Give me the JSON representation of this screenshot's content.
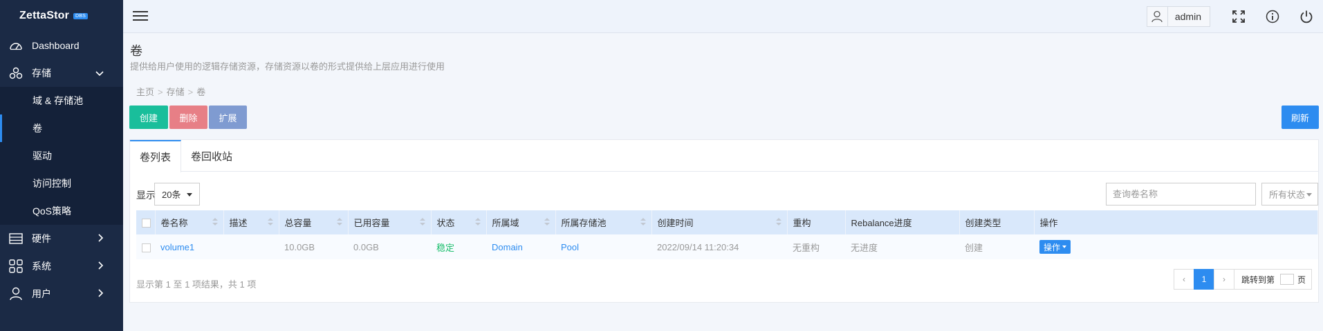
{
  "brand": {
    "name": "ZettaStor",
    "badge": "DBS"
  },
  "sidebar": {
    "items": [
      {
        "label": "Dashboard",
        "icon": "gauge-icon"
      },
      {
        "label": "存储",
        "icon": "cubes-icon",
        "expanded": true,
        "children": [
          {
            "label": "域 & 存储池"
          },
          {
            "label": "卷",
            "active": true
          },
          {
            "label": "驱动"
          },
          {
            "label": "访问控制"
          },
          {
            "label": "QoS策略"
          }
        ]
      },
      {
        "label": "硬件",
        "icon": "server-icon"
      },
      {
        "label": "系统",
        "icon": "grid-icon"
      },
      {
        "label": "用户",
        "icon": "user-icon"
      }
    ]
  },
  "topbar": {
    "user": "admin"
  },
  "page": {
    "title": "卷",
    "description": "提供给用户使用的逻辑存储资源，存储资源以卷的形式提供给上层应用进行使用",
    "breadcrumb": [
      "主页",
      "存储",
      "卷"
    ]
  },
  "toolbar": {
    "create": "创建",
    "delete": "删除",
    "expand": "扩展",
    "refresh": "刷新"
  },
  "tabs": [
    "卷列表",
    "卷回收站"
  ],
  "filters": {
    "show_label": "显示",
    "page_size": "20条",
    "search_placeholder": "查询卷名称",
    "status": "所有状态"
  },
  "table": {
    "columns": [
      "卷名称",
      "描述",
      "总容量",
      "已用容量",
      "状态",
      "所属域",
      "所属存储池",
      "创建时间",
      "重构",
      "Rebalance进度",
      "创建类型",
      "操作"
    ],
    "rows": [
      {
        "name": "volume1",
        "desc": "",
        "total": "10.0GB",
        "used": "0.0GB",
        "status": "稳定",
        "domain": "Domain",
        "pool": "Pool",
        "created": "2022/09/14 11:20:34",
        "rebuild": "无重构",
        "rebalance": "无进度",
        "type": "创建",
        "action": "操作"
      }
    ]
  },
  "footer": {
    "info": "显示第 1 至 1 项结果，共 1 项",
    "pager": {
      "prev": "‹",
      "current": "1",
      "next": "›",
      "jump_label": "跳转到第",
      "page_unit": "页"
    }
  },
  "colors": {
    "sidebar": "#1b2a45",
    "primary": "#2d8cf0",
    "create": "#19be9b",
    "delete": "#e77f86",
    "expand": "#7f9bd1",
    "success": "#19be6b"
  }
}
